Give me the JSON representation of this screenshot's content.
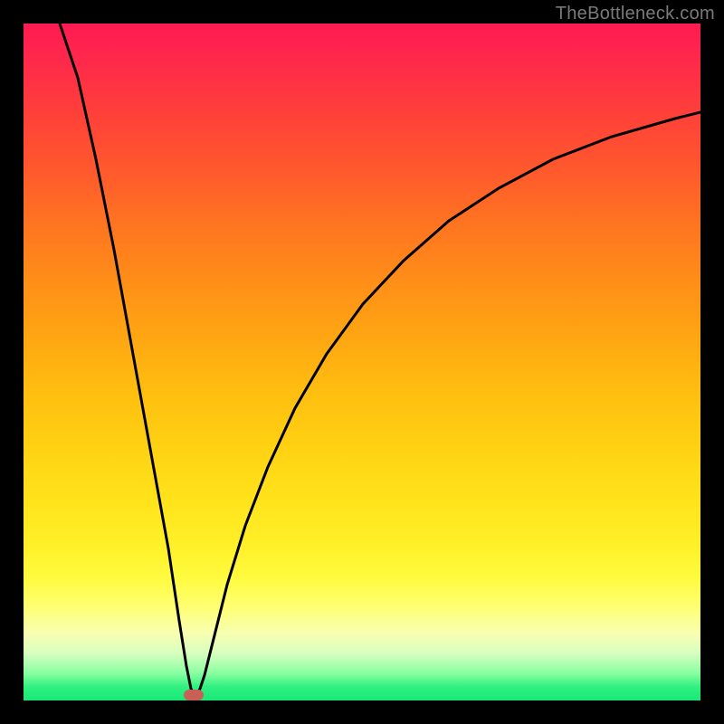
{
  "watermark": "TheBottleneck.com",
  "colors": {
    "background": "#000000",
    "gradient_top": "#ff1a52",
    "gradient_bottom": "#18e878",
    "curve": "#000000",
    "marker": "#c86058"
  },
  "chart_data": {
    "type": "line",
    "title": "",
    "xlabel": "",
    "ylabel": "",
    "xlim": [
      0,
      100
    ],
    "ylim": [
      0,
      100
    ],
    "grid": false,
    "notes": "V-shaped bottleneck curve. Left branch is near-vertical (steeply descending). Right branch rises with diminishing slope (logarithmic-like). Minimum near x≈24, y≈0. Y shown inverted visually (0 at bottom = green/good, 100 at top = red/bad).",
    "minimum": {
      "x": 24,
      "y": 0
    },
    "marker": {
      "x": 24,
      "y": 1
    },
    "series": [
      {
        "name": "left-branch",
        "x": [
          5,
          8,
          11,
          14,
          17,
          20,
          22,
          23,
          24
        ],
        "y": [
          100,
          84,
          68,
          52,
          36,
          20,
          9,
          4,
          0
        ]
      },
      {
        "name": "right-branch",
        "x": [
          24,
          26,
          28,
          31,
          35,
          40,
          46,
          53,
          61,
          70,
          80,
          90,
          100
        ],
        "y": [
          0,
          8,
          16,
          26,
          37,
          47,
          56,
          64,
          71,
          77,
          82,
          85,
          88
        ]
      }
    ]
  }
}
